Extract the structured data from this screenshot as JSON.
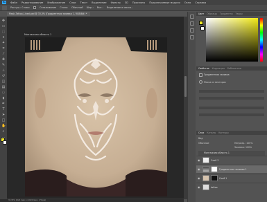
{
  "app": {
    "logo": "Ps"
  },
  "menu": [
    "Файл",
    "Редактирование",
    "Изображение",
    "Слои",
    "Текст",
    "Выделение",
    "Фильтр",
    "3D",
    "Просмотр",
    "Подключаемые модули",
    "Окно",
    "Справка"
  ],
  "options": {
    "feather_label": "Растуш.: 0 пикс",
    "smooth_label": "Сглаживание",
    "style_label": "Стиль:",
    "style_value": "Обычный",
    "width_label": "Шир.:",
    "height_label": "Выс.:",
    "select_mask": "Выделение и маска..."
  },
  "document": {
    "tab_title": "Mask_Tattoo_Lined.psd @ 33,3% (Градиентная заливка 1, RGB/8#) *",
    "artboard_name": "Монтажная область 1",
    "status": "33,33%  1024 пикс. x 1024 пикс. (72 ppi)"
  },
  "color_panel": {
    "tabs": [
      "Цвет",
      "Образцы",
      "Градиенты",
      "Узоры"
    ],
    "fg": "#f0e826",
    "bg": "#ffffff"
  },
  "properties_panel": {
    "tabs": [
      "Свойства",
      "Коррекция",
      "Библиотеки"
    ],
    "subtitle": "Градиентная заливка",
    "section": "Маска из векторов"
  },
  "layers_panel": {
    "tabs": [
      "Слои",
      "Каналы",
      "Контуры"
    ],
    "filter": "Вид",
    "blend_mode": "Обычные",
    "opacity": "Непрозр.: 100%",
    "fill": "Заливка: 100%",
    "group_name": "Монтажная область 1",
    "layers": [
      {
        "name": "Слой 3"
      },
      {
        "name": "Градиентная заливка 1"
      },
      {
        "name": "Слой 1"
      },
      {
        "name": "tattoo"
      }
    ]
  },
  "colors": {
    "accent": "#31a8ff",
    "foreground": "#f0e826"
  }
}
